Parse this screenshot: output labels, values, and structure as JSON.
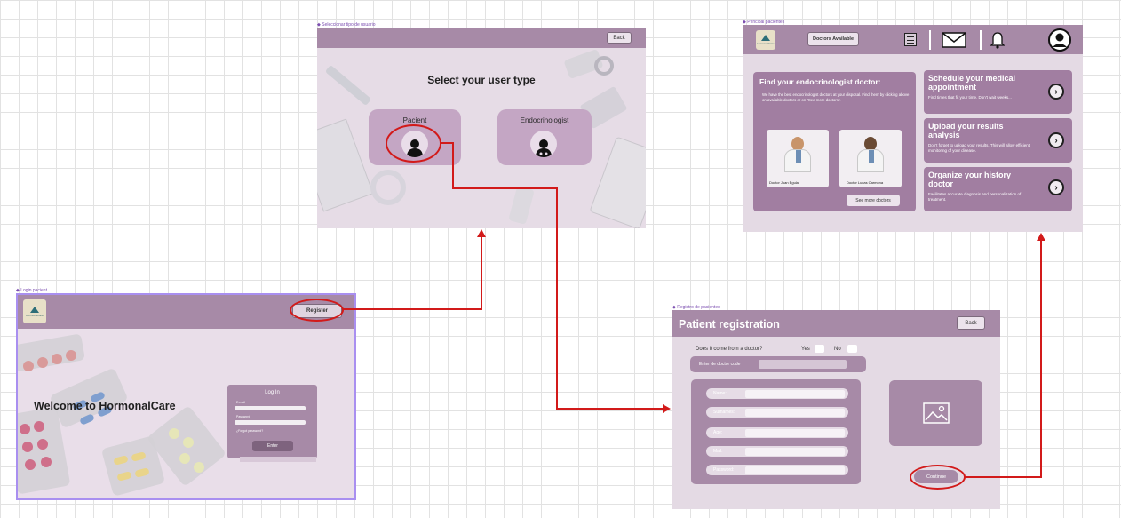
{
  "login": {
    "label": "Login pacient",
    "register_button": "Register",
    "welcome": "Welcome to HormonalCare",
    "login_title": "Log In",
    "email_label": "E-mail",
    "password_label": "Password",
    "forgot_label": "¿Forgot password?",
    "enter_button": "Enter",
    "logo_text": "HormonalCare"
  },
  "select_user": {
    "label": "Seleccionar tipo de usuario",
    "back_button": "Back",
    "title": "Select your user type",
    "patient_label": "Pacient",
    "endocrinologist_label": "Endocrinologist"
  },
  "principal": {
    "label": "Principal pacientes",
    "logo_text": "HormonalCare",
    "doctors_available_button": "Doctors Available",
    "find_title": "Find your endocrinologist doctor:",
    "find_desc": "We have the best endocrinologist doctors at your disposal. Find them by clicking above on available doctors or on \"See more doctors\".",
    "doctors": [
      {
        "name": "Doctor Juan Égula"
      },
      {
        "name": "Doctor Lucas Carmona"
      }
    ],
    "see_more_button": "See more doctors",
    "options": [
      {
        "title": "Schedule your medical appointment",
        "desc": "Find times that fit your time. Don't wait weeks..."
      },
      {
        "title": "Upload your results analysis",
        "desc": "Don't forget to upload your results. This will allow efficient monitoring of your disease."
      },
      {
        "title": "Organize your history doctor",
        "desc": "Facilitates accurate diagnosis and personalization of treatment."
      }
    ],
    "arrow_glyph": "›"
  },
  "registration": {
    "label": "Registro de pacientes",
    "title": "Patient registration",
    "back_button": "Back",
    "question": "Does it come from a doctor?",
    "yes": "Yes",
    "no": "No",
    "doctor_code_label": "Enter de doctor code",
    "fields": [
      "Name:",
      "Surnames:",
      "Age:",
      "Mail:",
      "Password:"
    ],
    "continue_button": "Continue"
  },
  "colors": {
    "accent": "#a78aa7",
    "frame_bg": "#e9dee9",
    "connector": "#d21a1a",
    "selection": "#9b6bff"
  }
}
